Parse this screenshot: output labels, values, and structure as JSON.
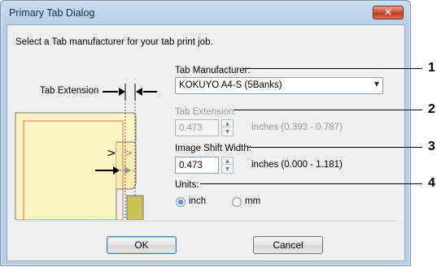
{
  "window": {
    "title": "Primary Tab Dialog",
    "close_symbol": "✕"
  },
  "instruction": "Select a Tab manufacturer for your tab print job.",
  "illustration": {
    "label": "Tab Extension"
  },
  "tab_manufacturer": {
    "label": "Tab Manufacturer:",
    "selected": "KOKUYO A4-S (5Banks)"
  },
  "tab_extension": {
    "label": "Tab Extension:",
    "value": "0.473",
    "range": "inches (0.393 - 0.787)",
    "enabled": false
  },
  "image_shift": {
    "label": "Image Shift Width:",
    "value": "0.473",
    "range": "inches (0.000 - 1.181)"
  },
  "units": {
    "label": "Units:",
    "options": [
      "inch",
      "mm"
    ],
    "selected": "inch"
  },
  "buttons": {
    "ok": "OK",
    "cancel": "Cancel"
  },
  "callouts": [
    "1",
    "2",
    "3",
    "4"
  ]
}
